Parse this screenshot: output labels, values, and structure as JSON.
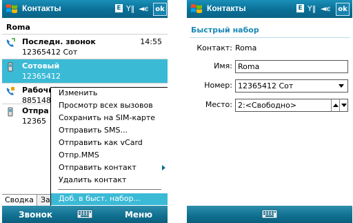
{
  "left": {
    "title": "Контакты",
    "status": {
      "e": "E",
      "signal": "Y‖",
      "sound": "◄ϵ",
      "ok": "ok"
    },
    "contact_name": "Roma",
    "entries": [
      {
        "name": "Последн. звонок",
        "sub": "12365412 Сот",
        "time": "14:55"
      },
      {
        "name": "Сотовый",
        "sub": "12365412"
      },
      {
        "name": "Рабочий",
        "sub": "885148"
      },
      {
        "name": "Отпра",
        "sub": "12365"
      }
    ],
    "tabs": [
      "Сводка",
      "За"
    ],
    "menu": {
      "items": [
        "Изменить",
        "Просмотр всех вызовов",
        "Сохранить на SIM-карте",
        "Отправить SMS...",
        "Отправить как vCard",
        "Отпр.MMS",
        "Отправить контакт",
        "Удалить контакт"
      ],
      "highlight": "Доб. в быст. набор..."
    },
    "softkeys": {
      "left": "Звонок",
      "right": "Меню"
    }
  },
  "right": {
    "title": "Контакты",
    "status": {
      "e": "E",
      "signal": "Y‖",
      "sound": "◄ϵ",
      "ok": "ok"
    },
    "subtitle": "Быстрый набор",
    "contact_label": "Контакт:",
    "contact_value": "Roma",
    "name_label": "Имя:",
    "name_value": "Roma",
    "number_label": "Номер:",
    "number_value": "12365412 Сот",
    "place_label": "Место:",
    "place_value": "2:<Свободно>"
  },
  "colors": {
    "titlebar": "#0a6f96",
    "selection": "#3bbad6",
    "accent_text": "#1a88b5"
  }
}
